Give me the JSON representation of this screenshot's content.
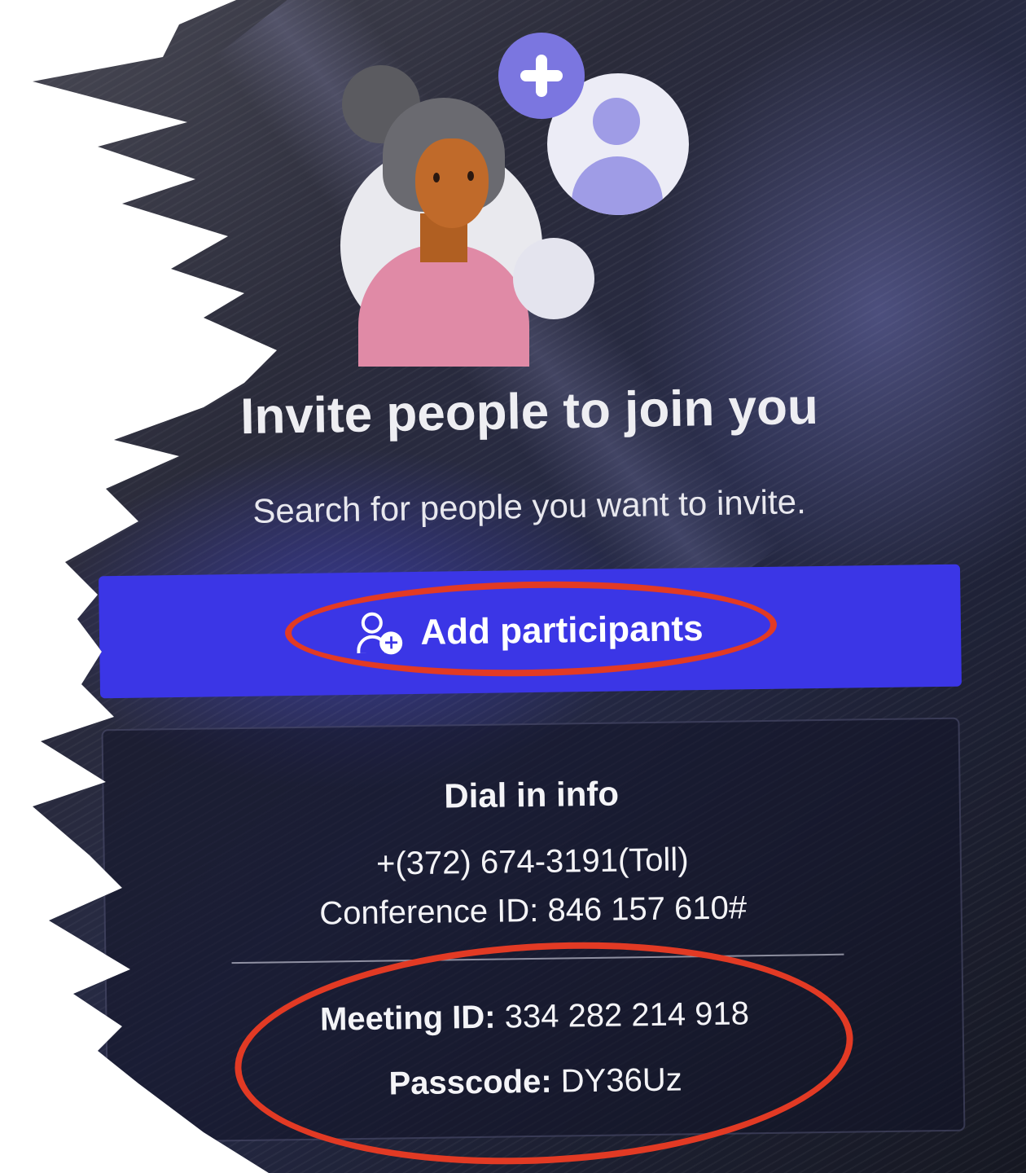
{
  "invite_panel": {
    "title": "Invite people to join you",
    "subtitle": "Search for people you want to invite.",
    "add_button": {
      "label": "Add participants",
      "icon": "add-person-icon"
    }
  },
  "dial_in": {
    "heading": "Dial in info",
    "phone": "+(372) 674-3191(Toll)",
    "conference_label": "Conference ID:",
    "conference_id": "846 157 610#",
    "meeting_label": "Meeting ID:",
    "meeting_id": "334 282 214 918",
    "passcode_label": "Passcode:",
    "passcode": "DY36Uz"
  },
  "colors": {
    "button": "#3b36e6",
    "annotation": "#e23a24",
    "avatar_accent": "#7b76e0"
  }
}
